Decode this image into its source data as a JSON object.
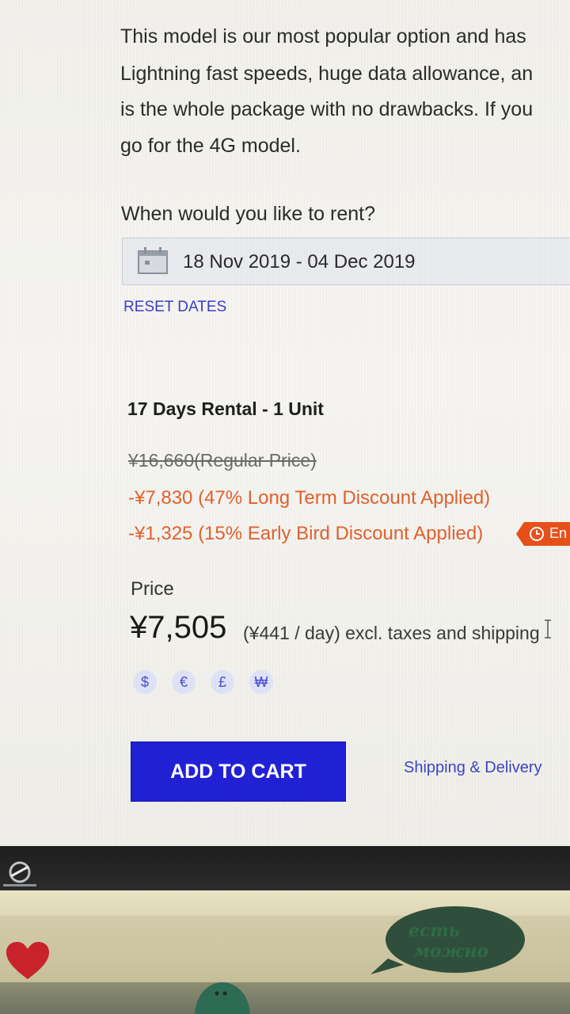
{
  "description": {
    "lines": [
      "This model is our most popular option and has",
      "Lightning fast speeds, huge data allowance, an",
      "is the whole package with no drawbacks. If you",
      "go for the 4G model."
    ]
  },
  "booking": {
    "question": "When would you like to rent?",
    "date_range": "18 Nov 2019 - 04 Dec 2019",
    "reset_label": "RESET DATES"
  },
  "summary": {
    "title": "17 Days Rental - 1 Unit",
    "regular_price": "¥16,660(Regular Price)",
    "long_term_discount": "-¥7,830 (47% Long Term Discount Applied)",
    "early_bird_discount": "-¥1,325 (15% Early Bird Discount Applied)",
    "early_badge_text": "En"
  },
  "price": {
    "label": "Price",
    "total": "¥7,505",
    "per_day_note": "(¥441 / day) excl. taxes and shipping"
  },
  "currencies": [
    "$",
    "€",
    "£",
    "₩"
  ],
  "actions": {
    "add_to_cart": "ADD TO CART",
    "shipping_link": "Shipping & Delivery"
  },
  "scene": {
    "sticker_line1": "есть",
    "sticker_line2": "можно"
  },
  "colors": {
    "accent_blue": "#2121d6",
    "link_blue": "#3a3ec8",
    "discount_orange": "#e0622e",
    "badge_orange": "#e8501b"
  },
  "icons": {
    "date_field": "calendar-icon",
    "badge": "clock-icon",
    "bezel": "monitor-logo-icon",
    "desk": "heart-icon"
  }
}
